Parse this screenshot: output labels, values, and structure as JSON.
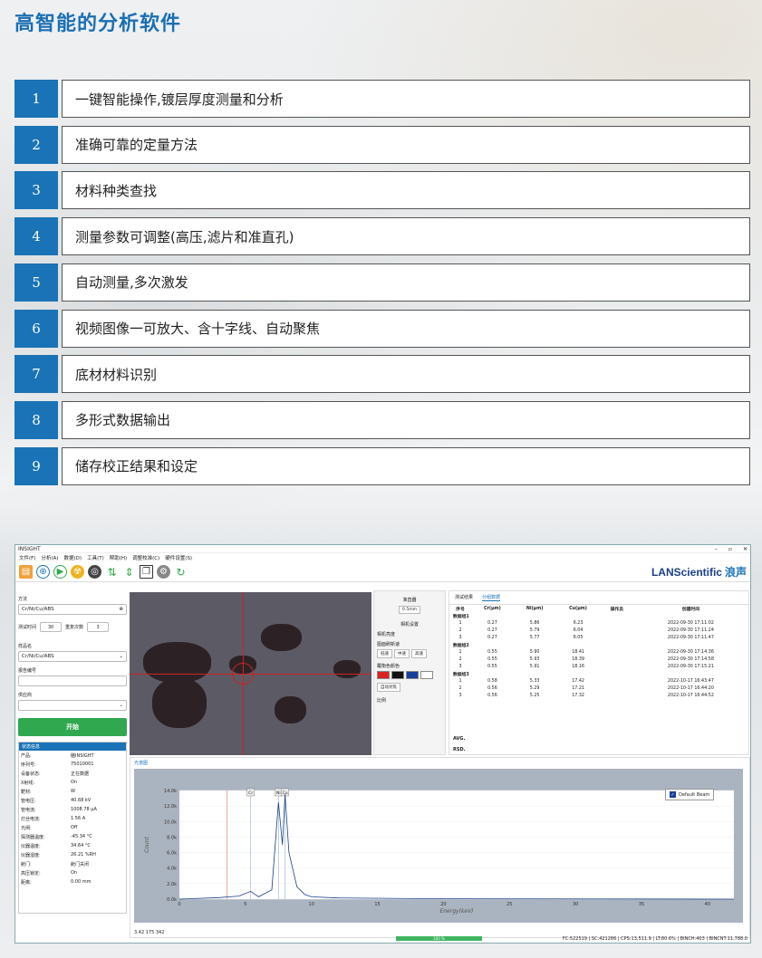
{
  "title": "高智能的分析软件",
  "features": [
    {
      "n": "1",
      "t": "一键智能操作,镀层厚度测量和分析"
    },
    {
      "n": "2",
      "t": "准确可靠的定量方法"
    },
    {
      "n": "3",
      "t": "材料种类查找"
    },
    {
      "n": "4",
      "t": "测量参数可调整(高压,滤片和准直孔)"
    },
    {
      "n": "5",
      "t": "自动测量,多次激发"
    },
    {
      "n": "6",
      "t": "视频图像一可放大、含十字线、自动聚焦"
    },
    {
      "n": "7",
      "t": "底材材料识别"
    },
    {
      "n": "8",
      "t": "多形式数据输出"
    },
    {
      "n": "9",
      "t": "储存校正结果和设定"
    }
  ],
  "app": {
    "window_title": "INSIGHT",
    "menu": [
      "文件(F)",
      "分析(A)",
      "数据(D)",
      "工具(T)",
      "帮助(H)",
      "调整校准(C)",
      "硬件设置(S)"
    ],
    "brand": "LANScientific",
    "brand_cn": "浪声",
    "left": {
      "method_label": "方法",
      "method_value": "Cr/Ni/Cu/ABS",
      "time_label": "测试时间",
      "time_value": "30",
      "repeat_label": "重复次数",
      "repeat_value": "3",
      "sample_label": "样品名",
      "sample_value": "Cr/Ni/Cu/ABS",
      "report_label": "报告编号",
      "supplier_label": "供应商",
      "start": "开始",
      "status_title": "状态信息",
      "status": [
        [
          "产品:",
          "脑INSIGHT"
        ],
        [
          "序列号:",
          "75010001"
        ],
        [
          "设备状态:",
          "正在数据"
        ],
        [
          "X射线:",
          "On"
        ],
        [
          "靶材:",
          "W"
        ],
        [
          "管电压:",
          "40.68 kV"
        ],
        [
          "管电流:",
          "1008.78 μA"
        ],
        [
          "灯丝电流:",
          "1.56 A"
        ],
        [
          "光闸:",
          "Off"
        ],
        [
          "探测器温度:",
          "-45.34 °C"
        ],
        [
          "仪器温度:",
          "34.64 °C"
        ],
        [
          "仪器湿度:",
          "26.21 %RH"
        ],
        [
          "舱门:",
          "舱门关闭"
        ],
        [
          "高压锁定:",
          "On"
        ],
        [
          "距离:",
          "0.00 mm"
        ]
      ]
    },
    "ctrl": {
      "collimator": "准直器",
      "coll_value": "0.5mm",
      "cam": "相机设置",
      "bright": "相机亮度",
      "speed_label": "图面刷新速",
      "speed": [
        "低速",
        "中速",
        "高速"
      ],
      "cross": "覆衡色颜色",
      "autofocus": "自动对焦",
      "ratio": "比例"
    },
    "tabs": [
      "测试结果",
      "分组数据"
    ],
    "table_headers": [
      "序号",
      "Cr(μm)",
      "Ni(μm)",
      "Cu(μm)",
      "操作员",
      "创建时间"
    ],
    "groups": [
      {
        "name": "数据组1",
        "rows": [
          [
            "1",
            "0.27",
            "5.86",
            "6.23",
            "",
            "2022-09-30 17:11:02"
          ],
          [
            "2",
            "0.27",
            "5.79",
            "6.04",
            "",
            "2022-09-30 17:11:24"
          ],
          [
            "3",
            "0.27",
            "5.77",
            "6.05",
            "",
            "2022-09-30 17:11:47"
          ]
        ]
      },
      {
        "name": "数据组2",
        "rows": [
          [
            "1",
            "0.55",
            "5.90",
            "18.41",
            "",
            "2022-09-30 17:14:36"
          ],
          [
            "2",
            "0.55",
            "5.93",
            "18.39",
            "",
            "2022-09-30 17:14:58"
          ],
          [
            "3",
            "0.55",
            "5.91",
            "18.16",
            "",
            "2022-09-30 17:15:21"
          ]
        ]
      },
      {
        "name": "数据组3",
        "rows": [
          [
            "1",
            "0.58",
            "5.33",
            "17.42",
            "",
            "2022-10-17 16:43:47"
          ],
          [
            "2",
            "0.56",
            "5.29",
            "17.21",
            "",
            "2022-10-17 16:44:20"
          ],
          [
            "3",
            "0.56",
            "5.25",
            "17.32",
            "",
            "2022-10-17 16:44:52"
          ]
        ]
      }
    ],
    "avg": "AVG.",
    "rsd": "RSD.",
    "spec_tab": "光谱图",
    "legend": "Default Beam",
    "coords": "3.42  175  342",
    "progress": "100 %",
    "statusbar": "FC:522519 | SC:421286 | CPS:13,511.9 | LT:80.6% | BINCH:403 | BINCNT:11,788.0"
  },
  "chart_data": {
    "type": "line",
    "xlabel": "Energy(keV)",
    "ylabel": "Count",
    "xlim": [
      0,
      42
    ],
    "ylim": [
      0,
      14000
    ],
    "x_ticks": [
      "0",
      "5",
      "10",
      "15",
      "20",
      "25",
      "30",
      "35",
      "40"
    ],
    "y_ticks": [
      "0.0k",
      "2.0k",
      "4.0k",
      "6.0k",
      "8.0k",
      "10.0k",
      "12.0k",
      "14.0k"
    ],
    "peaks": [
      {
        "label": "Cr",
        "x": 5.4
      },
      {
        "label": "Ni",
        "x": 7.5
      },
      {
        "label": "Cu",
        "x": 8.0
      }
    ],
    "series": [
      {
        "x": [
          0,
          3,
          4.5,
          5.4,
          6,
          7,
          7.5,
          7.8,
          8.0,
          8.3,
          8.9,
          9.5,
          10,
          12,
          20,
          42
        ],
        "y": [
          0,
          200,
          400,
          1000,
          300,
          1200,
          12500,
          7000,
          13500,
          6000,
          1600,
          600,
          300,
          150,
          50,
          0
        ]
      }
    ]
  }
}
